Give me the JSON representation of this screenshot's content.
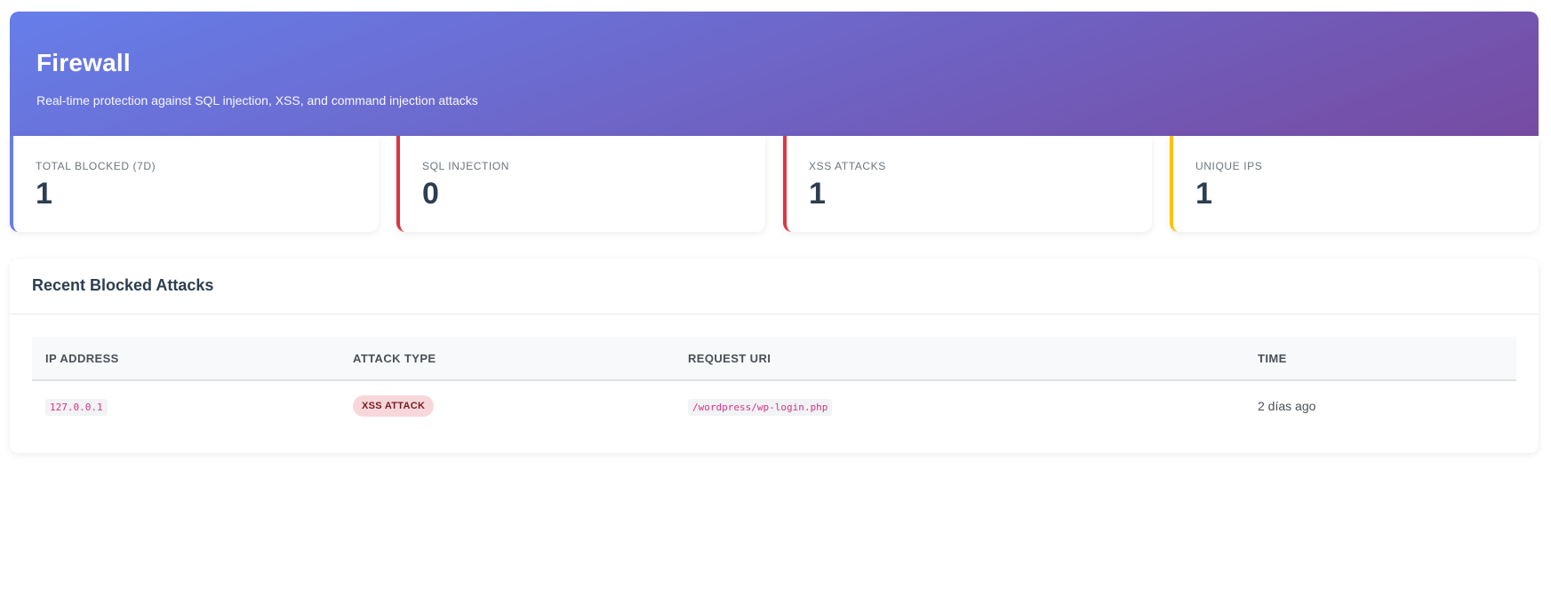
{
  "header": {
    "title": "Firewall",
    "subtitle": "Real-time protection against SQL injection, XSS, and command injection attacks"
  },
  "stats": [
    {
      "label": "TOTAL BLOCKED (7D)",
      "value": "1"
    },
    {
      "label": "SQL INJECTION",
      "value": "0"
    },
    {
      "label": "XSS ATTACKS",
      "value": "1"
    },
    {
      "label": "UNIQUE IPS",
      "value": "1"
    }
  ],
  "recent": {
    "title": "Recent Blocked Attacks",
    "columns": [
      "IP ADDRESS",
      "ATTACK TYPE",
      "REQUEST URI",
      "TIME"
    ],
    "rows": [
      {
        "ip": "127.0.0.1",
        "attack_type": "XSS ATTACK",
        "uri": "/wordpress/wp-login.php",
        "time": "2 días ago"
      }
    ]
  },
  "colors": {
    "gradient_start": "#667eea",
    "gradient_end": "#764ba2",
    "accent_blue": "#667eea",
    "accent_red": "#dc3545",
    "accent_yellow": "#ffc107",
    "badge_bg": "#f8d7da",
    "badge_text": "#721c24",
    "code_text": "#d63384"
  }
}
